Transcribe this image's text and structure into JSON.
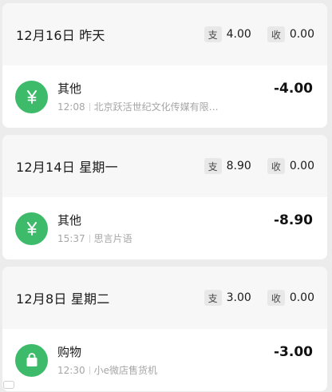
{
  "groups": [
    {
      "date": "12月16日 昨天",
      "expense_tag": "支",
      "expense": "4.00",
      "income_tag": "收",
      "income": "0.00",
      "tx": {
        "icon": "yuan-icon",
        "title": "其他",
        "time": "12:08",
        "merchant": "北京跃活世纪文化传媒有限…",
        "amount": "-4.00"
      }
    },
    {
      "date": "12月14日 星期一",
      "expense_tag": "支",
      "expense": "8.90",
      "income_tag": "收",
      "income": "0.00",
      "tx": {
        "icon": "yuan-icon",
        "title": "其他",
        "time": "15:37",
        "merchant": "思言片语",
        "amount": "-8.90"
      }
    },
    {
      "date": "12月8日 星期二",
      "expense_tag": "支",
      "expense": "3.00",
      "income_tag": "收",
      "income": "0.00",
      "tx": {
        "icon": "shopping-bag-icon",
        "title": "购物",
        "time": "12:30",
        "merchant": "小e微店售货机",
        "amount": "-3.00"
      }
    }
  ],
  "colors": {
    "icon_green": "#3dbb6a",
    "header_bg": "#f7f7f7",
    "page_bg": "#ececec"
  }
}
